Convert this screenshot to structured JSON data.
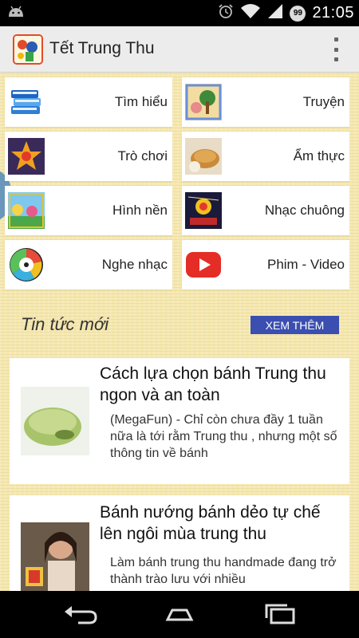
{
  "status_bar": {
    "time": "21:05",
    "battery_badge": "99",
    "icons": [
      "android-icon",
      "alarm-icon",
      "wifi-icon",
      "signal-icon"
    ]
  },
  "app_bar": {
    "title": "Tết Trung Thu"
  },
  "menu": {
    "items": [
      {
        "label": "Tìm hiểu",
        "icon": "books-icon"
      },
      {
        "label": "Truyện",
        "icon": "story-icon"
      },
      {
        "label": "Trò chơi",
        "icon": "lantern-icon"
      },
      {
        "label": "Ẩm thực",
        "icon": "mooncake-icon"
      },
      {
        "label": "Hình nền",
        "icon": "wallpaper-icon"
      },
      {
        "label": "Nhạc chuông",
        "icon": "ringtone-icon"
      },
      {
        "label": "Nghe nhạc",
        "icon": "music-disc-icon"
      },
      {
        "label": "Phim - Video",
        "icon": "youtube-play-icon"
      }
    ]
  },
  "news": {
    "header": "Tin tức mới",
    "more_label": "XEM THÊM",
    "articles": [
      {
        "title": "Cách lựa chọn bánh Trung thu ngon và an toàn",
        "summary": "(MegaFun) - Chỉ còn chưa đầy 1 tuần nữa là tới rằm Trung thu , nhưng một số thông tin về bánh"
      },
      {
        "title": "Bánh nướng bánh dẻo tự chế lên ngôi mùa trung thu",
        "summary": "Làm bánh trung thu handmade đang trở thành trào lưu với nhiều"
      }
    ]
  },
  "colors": {
    "background": "#f5e8b0",
    "action_bar": "#ececec",
    "more_button": "#3a4fb0",
    "logo_border": "#e24b2a",
    "youtube_red": "#e52d27"
  },
  "nav_bar": {
    "icons": [
      "back-icon",
      "home-icon",
      "recents-icon"
    ]
  }
}
